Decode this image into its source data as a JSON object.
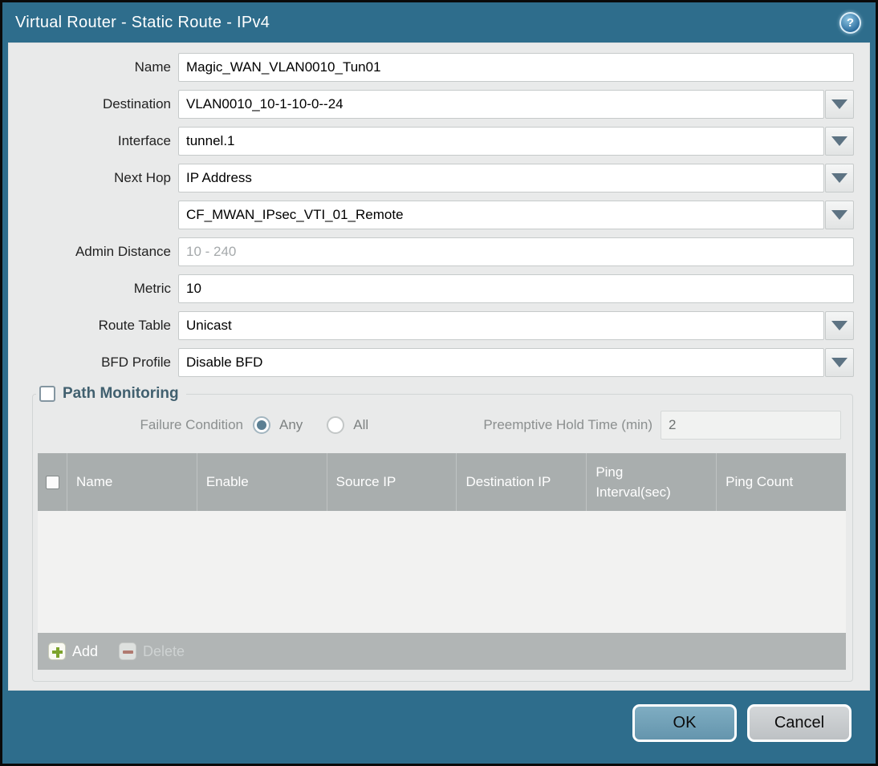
{
  "window": {
    "title": "Virtual Router - Static Route - IPv4",
    "help_icon": "?"
  },
  "form": {
    "fields": [
      {
        "label": "Name",
        "value": "Magic_WAN_VLAN0010_Tun01"
      },
      {
        "label": "Destination",
        "value": "VLAN0010_10-1-10-0--24"
      },
      {
        "label": "Interface",
        "value": "tunnel.1"
      },
      {
        "label": "Next Hop",
        "value": "IP Address"
      },
      {
        "label": "",
        "value": "CF_MWAN_IPsec_VTI_01_Remote"
      },
      {
        "label": "Admin Distance",
        "placeholder": "10 - 240"
      },
      {
        "label": "Metric",
        "value": "10"
      },
      {
        "label": "Route Table",
        "value": "Unicast"
      },
      {
        "label": "BFD Profile",
        "value": "Disable BFD"
      }
    ]
  },
  "path_monitoring": {
    "legend": "Path Monitoring",
    "enabled": false,
    "failure_condition_label": "Failure Condition",
    "option_any": "Any",
    "option_all": "All",
    "failure_condition_selected": "Any",
    "preemptive_label": "Preemptive Hold Time (min)",
    "preemptive_value": "2",
    "table": {
      "columns": [
        "Name",
        "Enable",
        "Source IP",
        "Destination IP",
        "Ping Interval(sec)",
        "Ping Count"
      ],
      "rows": []
    },
    "add_label": "Add",
    "delete_label": "Delete"
  },
  "footer": {
    "ok_label": "OK",
    "cancel_label": "Cancel"
  },
  "colors": {
    "titlebar": "#2e6d8c",
    "panel_bg": "#e9eaea",
    "table_header": "#a9aeae",
    "table_footer_bar": "#b1b5b5",
    "ok_button": "#6f9fb7",
    "cancel_button": "#c7cacc",
    "add_icon_green": "#7da32b",
    "delete_icon_red": "#b07a70",
    "radio_selected": "#5b7f93"
  }
}
